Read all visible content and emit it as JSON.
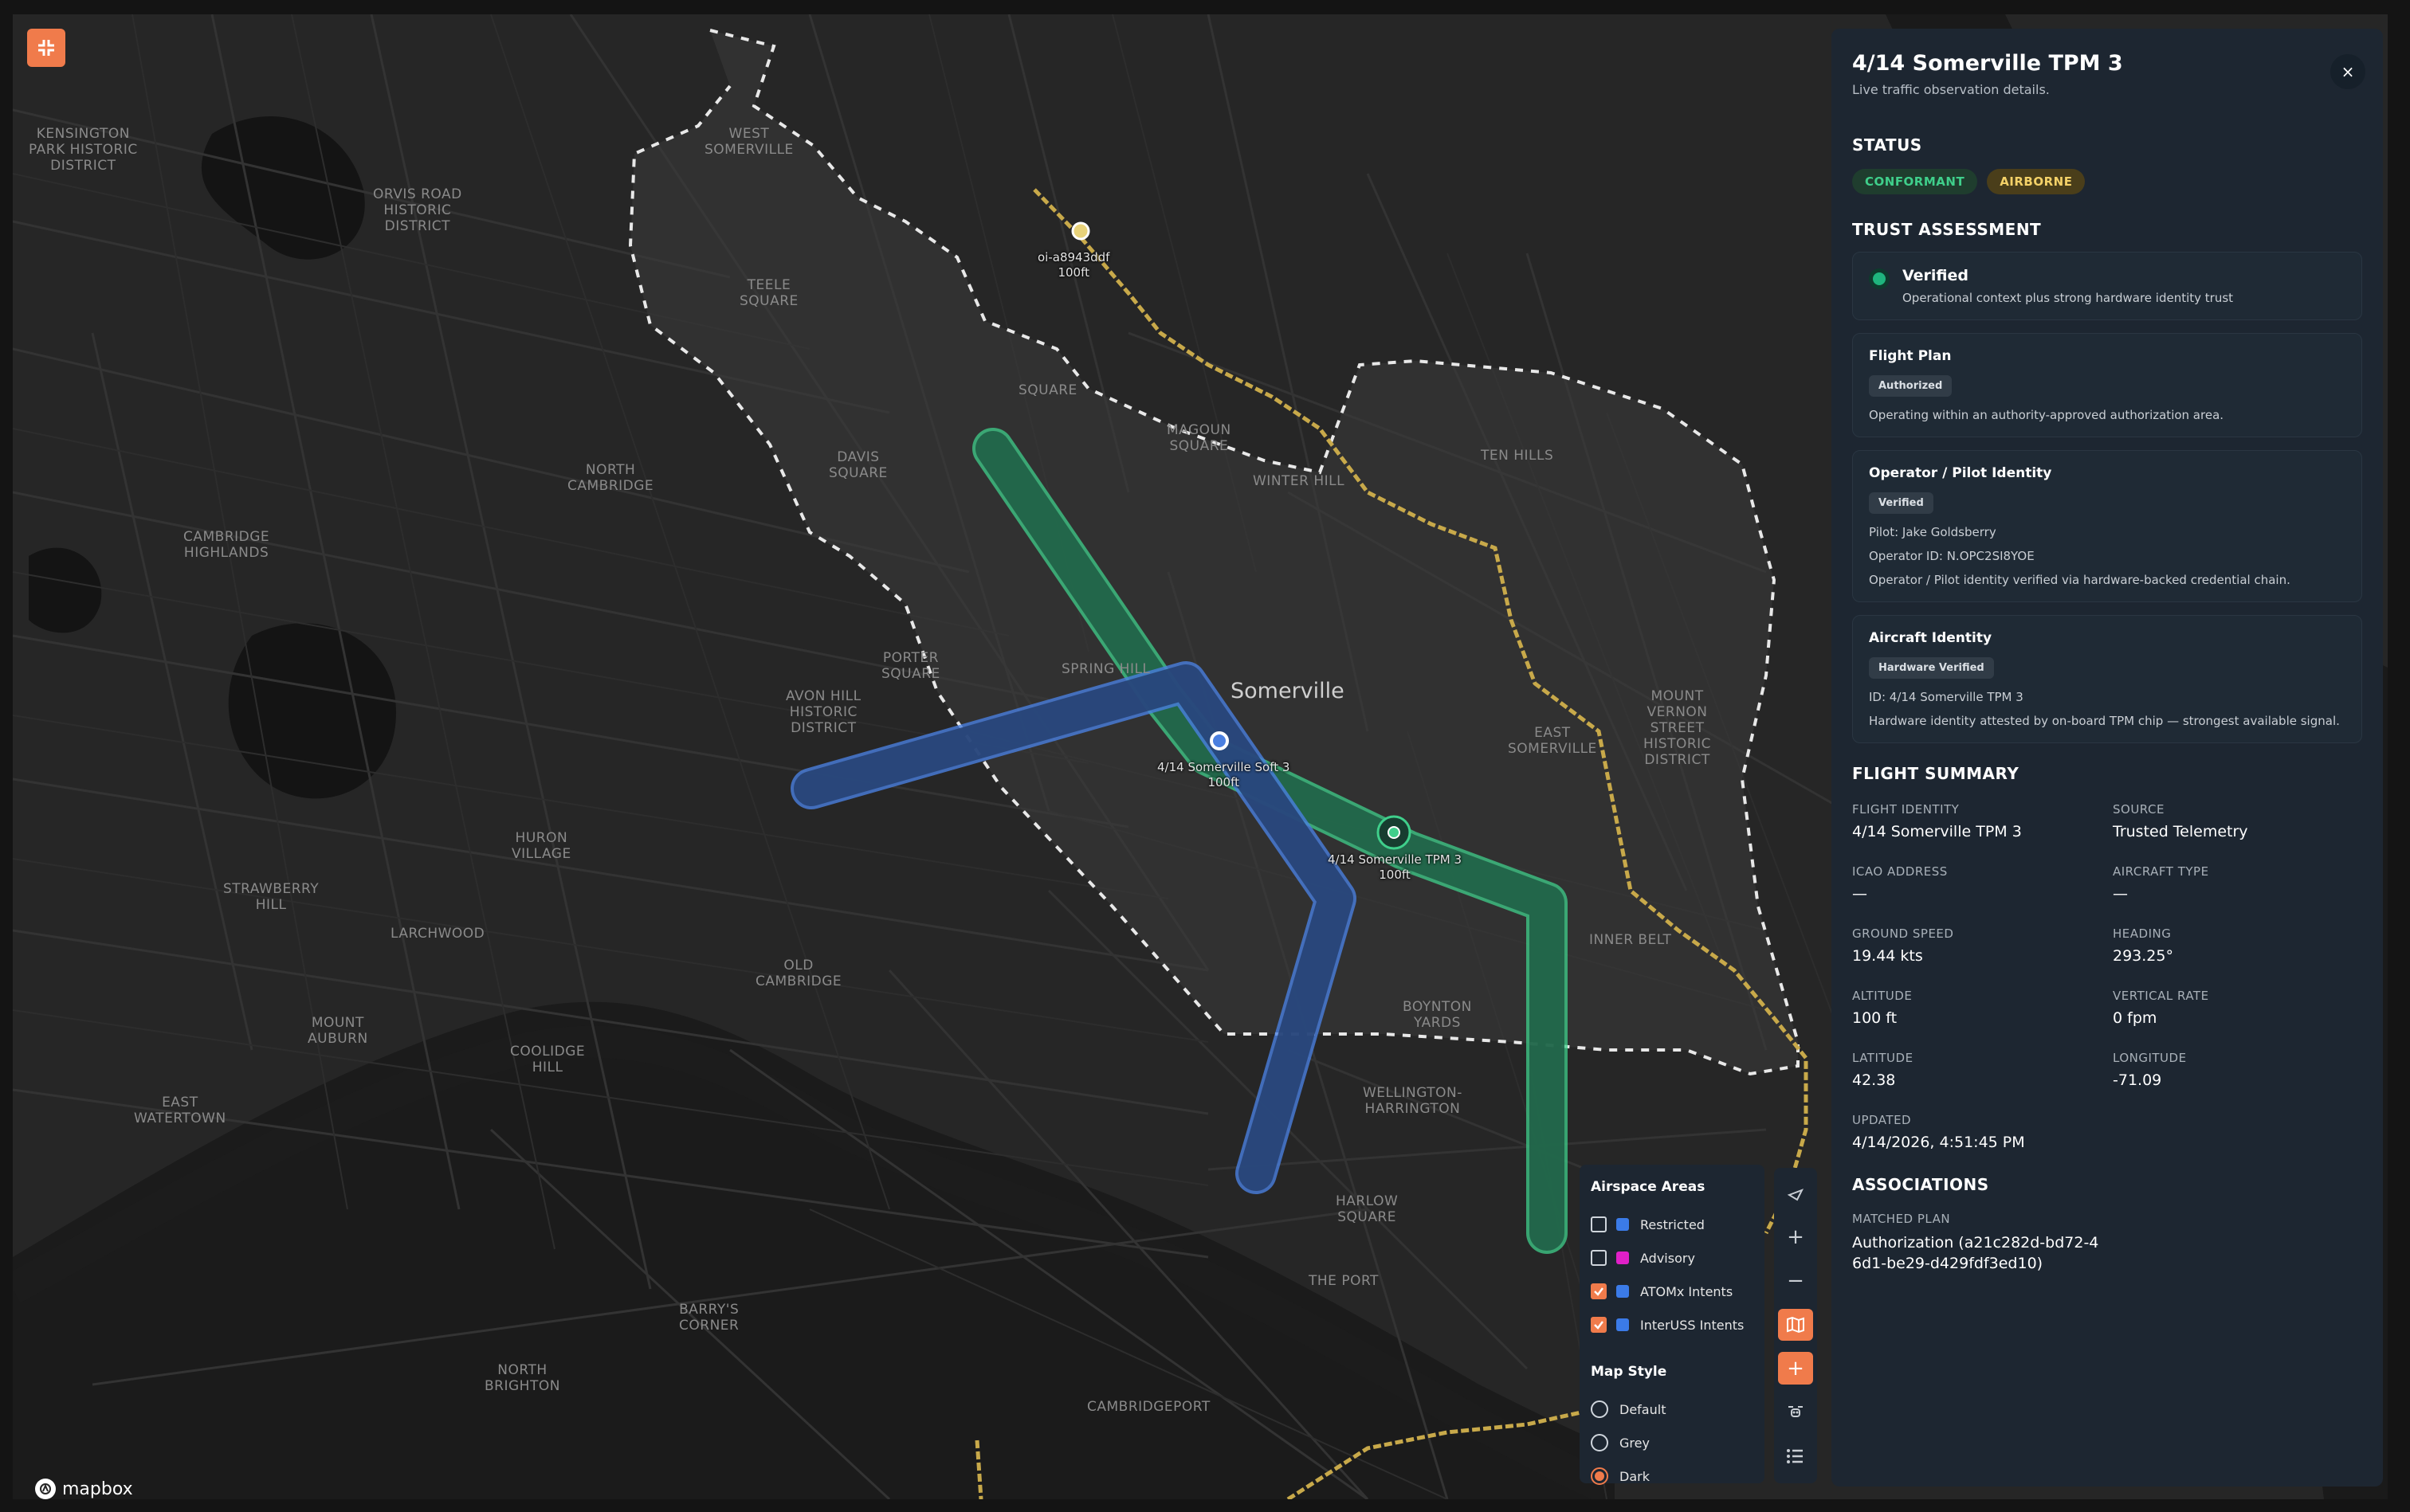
{
  "map": {
    "city_name": "Somerville",
    "places": [
      {
        "text": "KENSINGTON\nPARK HISTORIC\nDISTRICT"
      },
      {
        "text": "ORVIS ROAD\nHISTORIC\nDISTRICT"
      },
      {
        "text": "WEST\nSOMERVILLE"
      },
      {
        "text": "TEELE\nSQUARE"
      },
      {
        "text": "DAVIS\nSQUARE"
      },
      {
        "text": "NORTH\nCAMBRIDGE"
      },
      {
        "text": "CAMBRIDGE\nHIGHLANDS"
      },
      {
        "text": "PORTER\nSQUARE"
      },
      {
        "text": "AVON HILL\nHISTORIC\nDISTRICT"
      },
      {
        "text": "HURON\nVILLAGE"
      },
      {
        "text": "STRAWBERRY\nHILL"
      },
      {
        "text": "LARCHWOOD"
      },
      {
        "text": "OLD\nCAMBRIDGE"
      },
      {
        "text": "MOUNT\nAUBURN"
      },
      {
        "text": "COOLIDGE\nHILL"
      },
      {
        "text": "EAST\nWATERTOWN"
      },
      {
        "text": "SPRING HILL"
      },
      {
        "text": "WINTER HILL"
      },
      {
        "text": "TEN HILLS"
      },
      {
        "text": "EAST\nSOMERVILLE"
      },
      {
        "text": "MOUNT\nVERNON\nSTREET\nHISTORIC\nDISTRICT"
      },
      {
        "text": "INNER BELT"
      },
      {
        "text": "BOYNTON\nYARDS"
      },
      {
        "text": "WELLINGTON-\nHARRINGTON"
      },
      {
        "text": "HARLOW\nSQUARE"
      },
      {
        "text": "THE PORT"
      },
      {
        "text": "BARRY'S\nCORNER"
      },
      {
        "text": "NORTH\nBRIGHTON"
      },
      {
        "text": "CAMBRIDGEPORT"
      },
      {
        "text": "SQUARE"
      },
      {
        "text": "MAGOUN\nSQUARE"
      }
    ],
    "flights": [
      {
        "label": "oi-a8943ddf\n100ft"
      },
      {
        "label": "4/14 Somerville Soft 3\n100ft"
      },
      {
        "label": "4/14 Somerville TPM 3\n100ft"
      }
    ],
    "attribution": "mapbox",
    "colors": {
      "green_intent": "#3fcf8b",
      "blue_intent": "#4a7fe0",
      "track": "#c8a94a",
      "accent": "#f07b4b"
    }
  },
  "layers": {
    "airspace_title": "Airspace Areas",
    "areas": [
      {
        "label": "Restricted",
        "checked": false,
        "color": "#3b7be8"
      },
      {
        "label": "Advisory",
        "checked": false,
        "color": "#e020c8"
      },
      {
        "label": "ATOMx Intents",
        "checked": true,
        "color": "#3b7be8"
      },
      {
        "label": "InterUSS Intents",
        "checked": true,
        "color": "#3b7be8"
      }
    ],
    "style_title": "Map Style",
    "styles": [
      {
        "label": "Default",
        "selected": false
      },
      {
        "label": "Grey",
        "selected": false
      },
      {
        "label": "Dark",
        "selected": true
      }
    ]
  },
  "toolbar": {
    "zoom_in": "+",
    "zoom_out": "−",
    "add": "+"
  },
  "panel": {
    "title": "4/14 Somerville TPM 3",
    "subtitle": "Live traffic observation details.",
    "close": "×",
    "status_title": "STATUS",
    "status_badges": [
      "CONFORMANT",
      "AIRBORNE"
    ],
    "trust_title": "TRUST ASSESSMENT",
    "trust": {
      "verdict": "Verified",
      "description": "Operational context plus strong hardware identity trust"
    },
    "flight_plan": {
      "title": "Flight Plan",
      "tag": "Authorized",
      "text": "Operating within an authority-approved authorization area."
    },
    "operator": {
      "title": "Operator / Pilot Identity",
      "tag": "Verified",
      "pilot": "Pilot: Jake Goldsberry",
      "operator_id": "Operator ID: N.OPC2SI8YOE",
      "text": "Operator / Pilot identity verified via hardware-backed credential chain."
    },
    "aircraft": {
      "title": "Aircraft Identity",
      "tag": "Hardware Verified",
      "id": "ID: 4/14 Somerville TPM 3",
      "text": "Hardware identity attested by on-board TPM chip — strongest available signal."
    },
    "summary_title": "FLIGHT SUMMARY",
    "summary": [
      {
        "label": "FLIGHT IDENTITY",
        "value": "4/14 Somerville TPM 3"
      },
      {
        "label": "SOURCE",
        "value": "Trusted Telemetry"
      },
      {
        "label": "ICAO ADDRESS",
        "value": "—"
      },
      {
        "label": "AIRCRAFT TYPE",
        "value": "—"
      },
      {
        "label": "GROUND SPEED",
        "value": "19.44 kts"
      },
      {
        "label": "HEADING",
        "value": "293.25°"
      },
      {
        "label": "ALTITUDE",
        "value": "100 ft"
      },
      {
        "label": "VERTICAL RATE",
        "value": "0 fpm"
      },
      {
        "label": "LATITUDE",
        "value": "42.38"
      },
      {
        "label": "LONGITUDE",
        "value": "-71.09"
      }
    ],
    "updated_label": "UPDATED",
    "updated_value": "4/14/2026, 4:51:45 PM",
    "assoc_title": "ASSOCIATIONS",
    "matched_label": "MATCHED PLAN",
    "matched_value": "Authorization (a21c282d-bd72-46d1-be29-d429fdf3ed10)"
  }
}
